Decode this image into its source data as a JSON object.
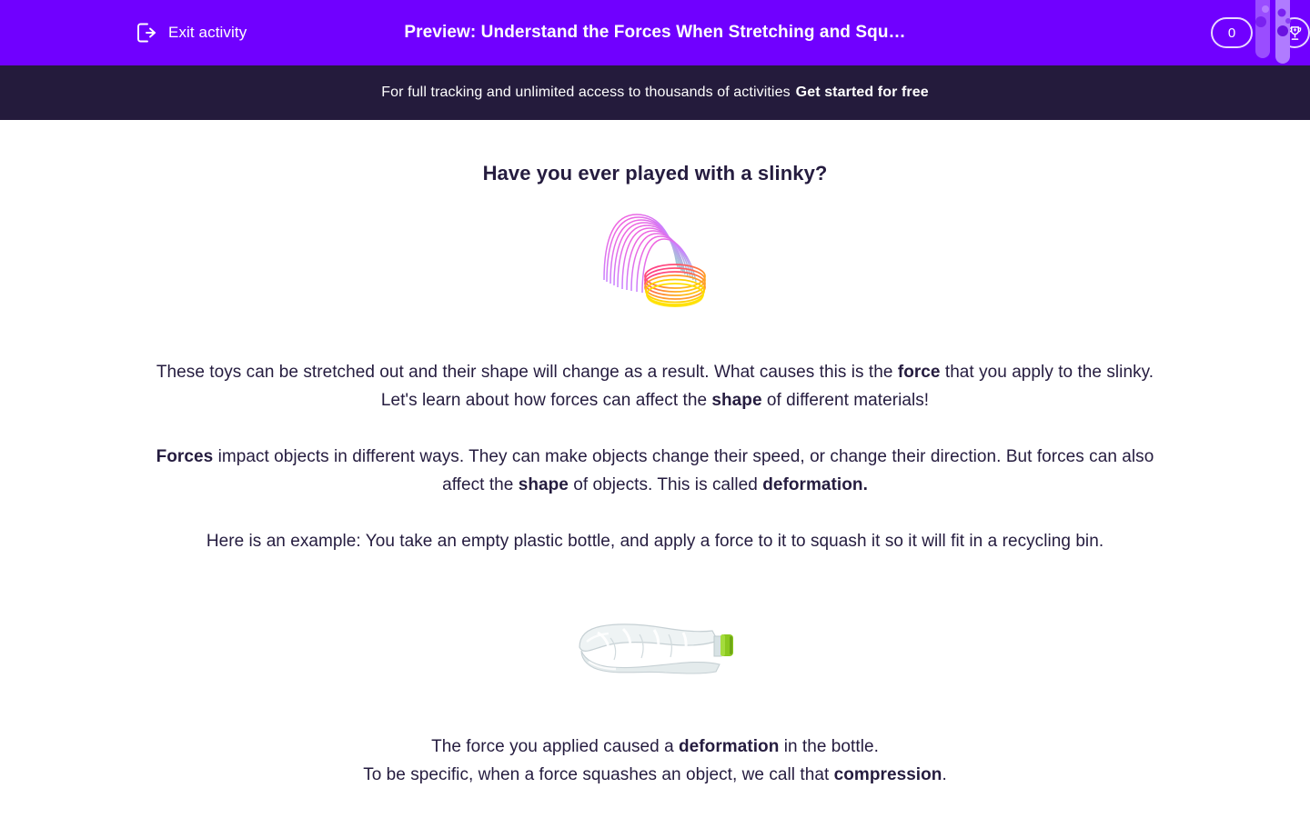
{
  "header": {
    "exit_label": "Exit activity",
    "exit_icon": "exit-door-arrow-icon",
    "title": "Preview: Understand the Forces When Stretching and Squ…",
    "score_value": "0",
    "trophy_icon": "trophy-icon",
    "decor_icon": "test-tubes-icon",
    "bg_color": "#7000ff"
  },
  "promo": {
    "text": "For full tracking and unlimited access to thousands of activities",
    "cta": "Get started for free",
    "bg_color": "#241b3c"
  },
  "lesson": {
    "heading": "Have you ever played with a slinky?",
    "slinky_image_alt": "rainbow-slinky-image",
    "bottle_image_alt": "crushed-plastic-bottle-image",
    "paragraphs": {
      "p1_a": "These toys can be stretched out and their shape will change as a result. What causes this is the ",
      "p1_b1": "force",
      "p1_b": " that you apply to the slinky. Let's learn about how forces can affect the ",
      "p1_b2": "shape",
      "p1_c": " of different materials!",
      "p2_b1": "Forces",
      "p2_a": " impact objects in different ways. They can make objects change their speed, or change their direction. But forces can also affect the ",
      "p2_b2": "shape",
      "p2_b": " of objects. This is called ",
      "p2_b3": "deformation.",
      "p3": "Here is an example: You take an empty plastic bottle, and apply a force to it to squash it so it will fit in a recycling bin.",
      "p4_a": "The force you applied caused a ",
      "p4_b1": "deformation",
      "p4_b": " in the bottle.",
      "p5_a": "To be specific, when a force squashes an object, we call that ",
      "p5_b1": "compression",
      "p5_b": "."
    },
    "text_color": "#251c3f"
  }
}
